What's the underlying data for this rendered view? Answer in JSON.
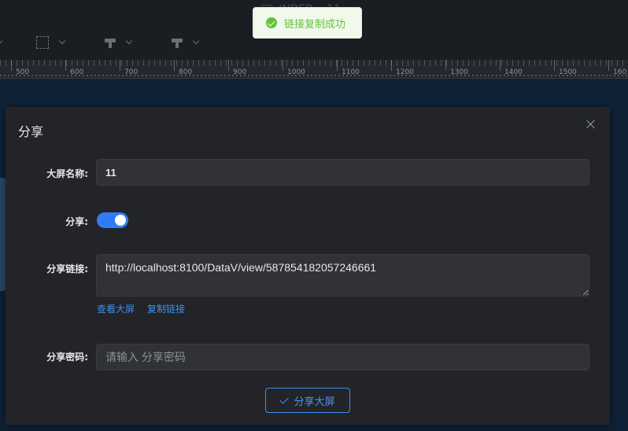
{
  "app": {
    "title": "INDEP… 11"
  },
  "toast": {
    "message": "链接复制成功",
    "color": "#67c23a"
  },
  "ruler": {
    "labels": [
      "500",
      "600",
      "700",
      "800",
      "900",
      "1000",
      "1100",
      "1200",
      "1300",
      "1400",
      "1500",
      "160"
    ]
  },
  "dialog": {
    "title": "分享",
    "fields": {
      "screen_name": {
        "label": "大屏名称:",
        "value": "11"
      },
      "share": {
        "label": "分享:",
        "enabled": true
      },
      "share_link": {
        "label": "分享链接:",
        "value": "http://localhost:8100/DataV/view/587854182057246661"
      },
      "password": {
        "label": "分享密码:",
        "placeholder": "请输入 分享密码"
      }
    },
    "links": {
      "view_screen": "查看大屏",
      "copy_link": "复制链接"
    },
    "submit_label": "分享大屏"
  },
  "colors": {
    "accent": "#3d8ff5",
    "switch_on": "#2f7cf6",
    "dialog_bg": "#232427"
  }
}
